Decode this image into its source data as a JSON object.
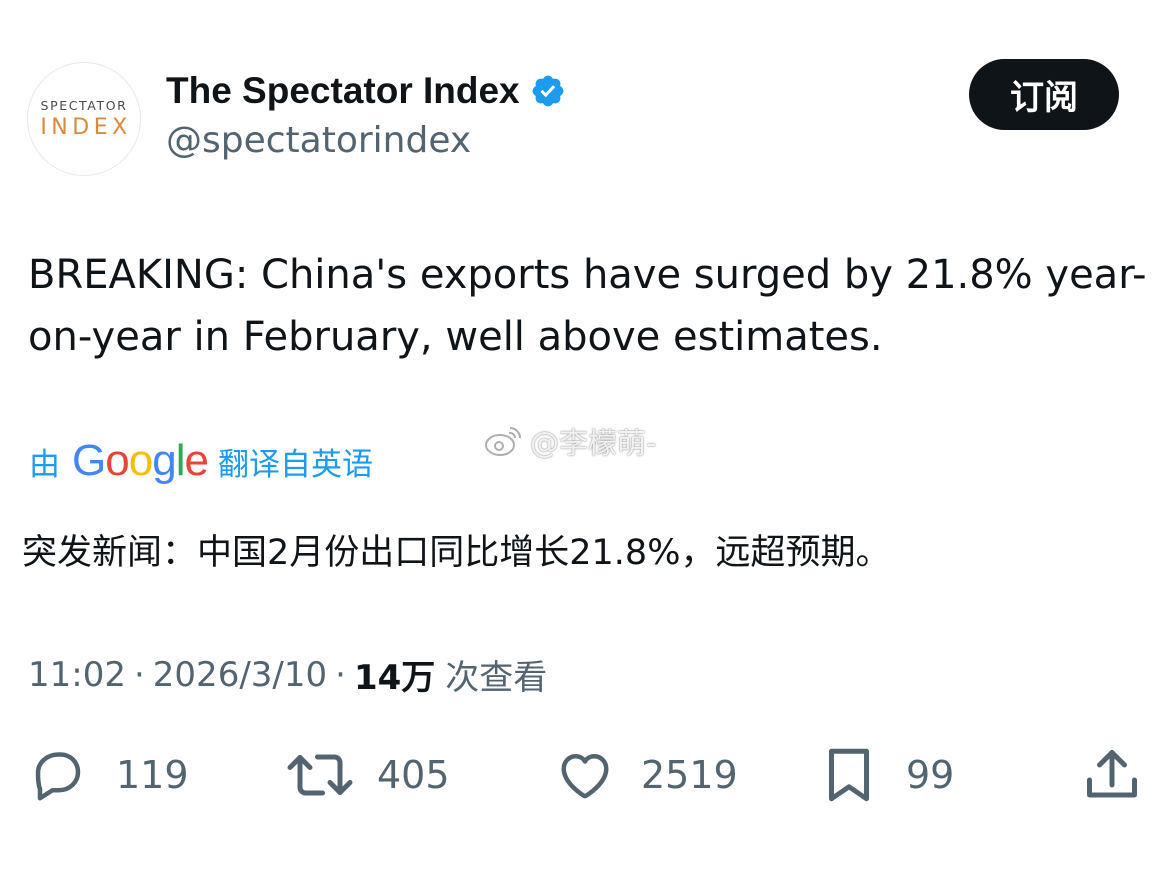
{
  "account": {
    "avatar_top": "SPECTATOR",
    "avatar_bottom": "INDEX",
    "name": "The Spectator Index",
    "handle": "@spectatorindex",
    "subscribe_label": "订阅"
  },
  "tweet": {
    "text": "BREAKING: China's exports have surged by 21.8% year-on-year in February, well above estimates.",
    "translate_prefix": "由",
    "translate_brand": "Google",
    "translate_suffix": "翻译自英语",
    "translated_text": "突发新闻：中国2月份出口同比增长21.8%，远超预期。"
  },
  "watermark": {
    "text": "@李檬萌-"
  },
  "meta": {
    "time": "11:02",
    "date": "2026/3/10",
    "separator": "·",
    "views_count": "14万",
    "views_label": "次查看"
  },
  "actions": {
    "replies": "119",
    "reposts": "405",
    "likes": "2519",
    "bookmarks": "99"
  },
  "colors": {
    "accent": "#1d9bf0",
    "text": "#0f1419",
    "secondary": "#536471",
    "avatar_orange": "#d98a3f"
  }
}
